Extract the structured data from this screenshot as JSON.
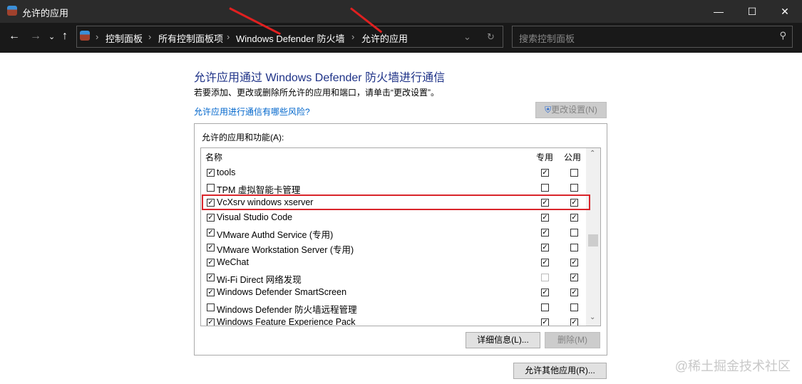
{
  "window": {
    "title": "允许的应用",
    "min": "—",
    "max": "☐",
    "close": "✕"
  },
  "address": {
    "crumbs": [
      "控制面板",
      "所有控制面板项",
      "Windows Defender 防火墙",
      "允许的应用"
    ],
    "search_placeholder": "搜索控制面板"
  },
  "main": {
    "heading": "允许应用通过 Windows Defender 防火墙进行通信",
    "description": "若要添加、更改或删除所允许的应用和端口，请单击“更改设置”。",
    "risk_link": "允许应用进行通信有哪些风险?",
    "change_settings": "更改设置(N)",
    "list_label": "允许的应用和功能(A):",
    "col_name": "名称",
    "col_private": "专用",
    "col_public": "公用",
    "details_button": "详细信息(L)...",
    "delete_button": "删除(M)",
    "allow_other_button": "允许其他应用(R)..."
  },
  "apps": [
    {
      "name": "tools",
      "enabled": true,
      "private": true,
      "public": false
    },
    {
      "name": "TPM 虚拟智能卡管理",
      "enabled": false,
      "private": false,
      "public": false
    },
    {
      "name": "VcXsrv windows xserver",
      "enabled": true,
      "private": true,
      "public": true
    },
    {
      "name": "Visual Studio Code",
      "enabled": true,
      "private": true,
      "public": true
    },
    {
      "name": "VMware Authd Service (专用)",
      "enabled": true,
      "private": true,
      "public": false
    },
    {
      "name": "VMware Workstation Server (专用)",
      "enabled": true,
      "private": true,
      "public": false
    },
    {
      "name": "WeChat",
      "enabled": true,
      "private": true,
      "public": true
    },
    {
      "name": "Wi-Fi Direct 网络发现",
      "enabled": true,
      "private": false,
      "public": true,
      "private_disabled": true
    },
    {
      "name": "Windows Defender SmartScreen",
      "enabled": true,
      "private": true,
      "public": true
    },
    {
      "name": "Windows Defender 防火墙远程管理",
      "enabled": false,
      "private": false,
      "public": false
    },
    {
      "name": "Windows Feature Experience Pack",
      "enabled": true,
      "private": true,
      "public": true
    }
  ],
  "watermark": "@稀土掘金技术社区"
}
